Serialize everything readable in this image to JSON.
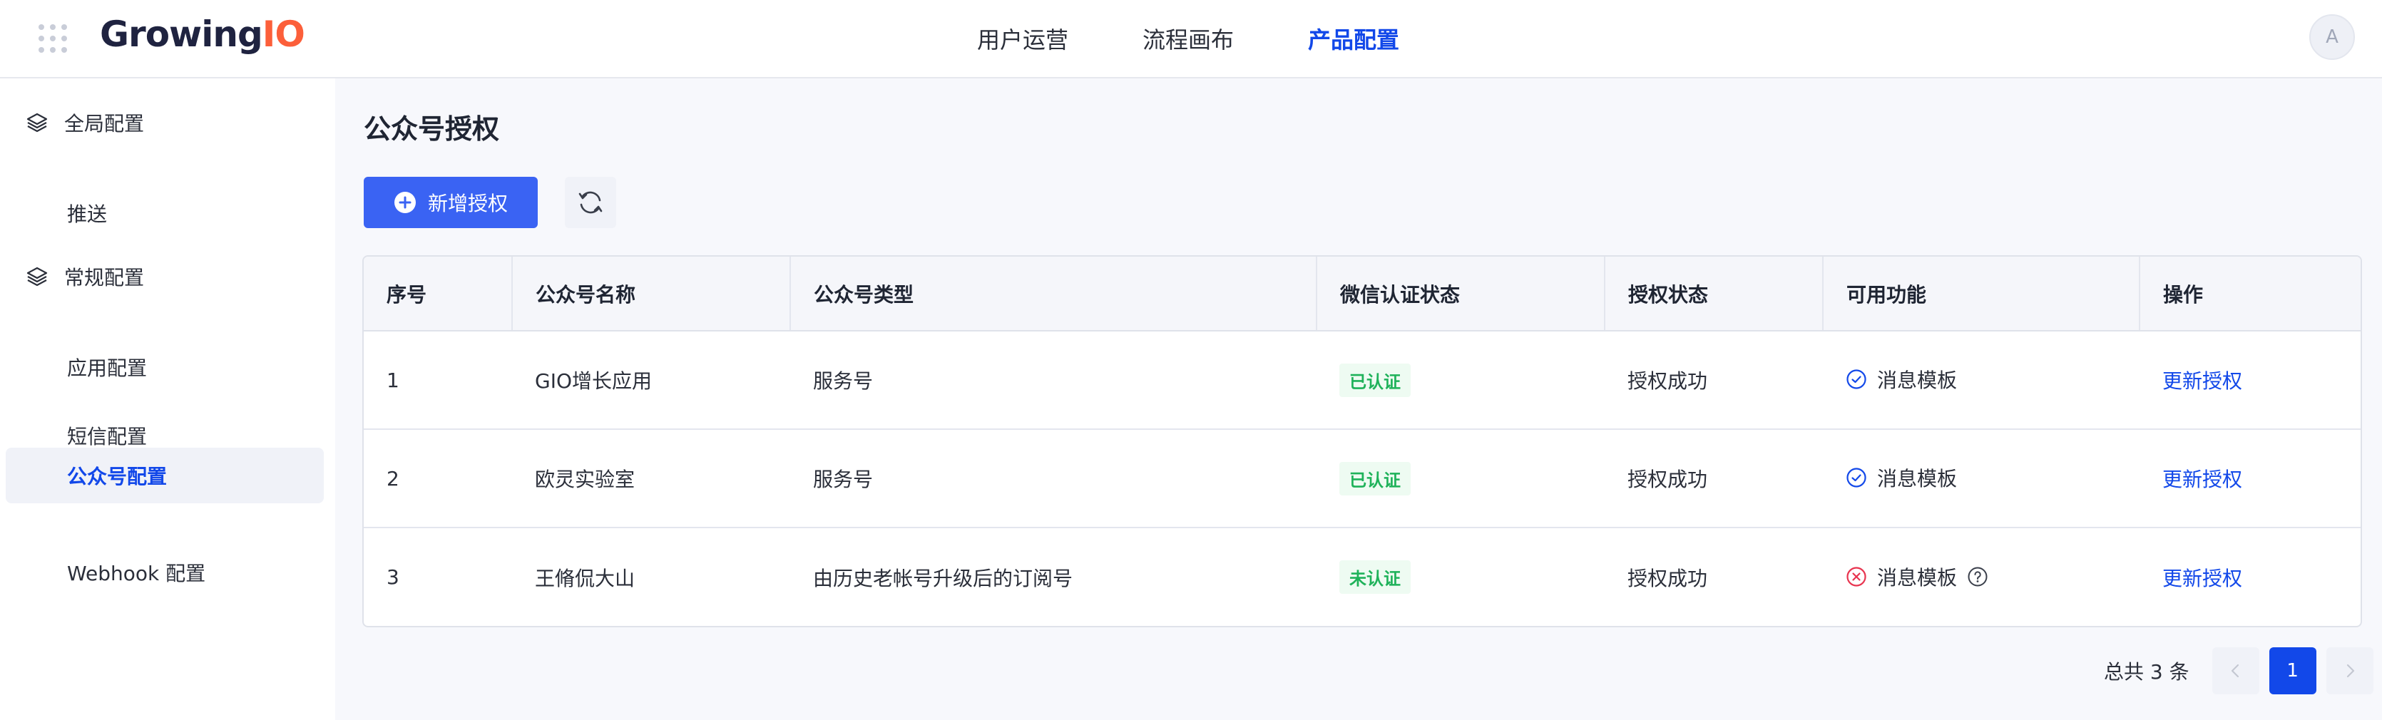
{
  "header": {
    "logo_text": "Growing",
    "logo_accent": "IO",
    "nav": [
      {
        "label": "用户运营"
      },
      {
        "label": "流程画布"
      },
      {
        "label": "产品配置"
      }
    ],
    "active_nav": "产品配置",
    "avatar_initial": "A"
  },
  "sidebar": {
    "groups": [
      {
        "label": "全局配置",
        "items": [
          {
            "label": "推送"
          }
        ]
      },
      {
        "label": "常规配置",
        "items": [
          {
            "label": "应用配置"
          },
          {
            "label": "短信配置"
          },
          {
            "label": "公众号配置"
          },
          {
            "label": "Webhook 配置"
          }
        ]
      }
    ],
    "active_item": "公众号配置"
  },
  "main": {
    "title": "公众号授权",
    "add_button_label": "新增授权",
    "table": {
      "columns": [
        "序号",
        "公众号名称",
        "公众号类型",
        "微信认证状态",
        "授权状态",
        "可用功能",
        "操作"
      ],
      "rows": [
        {
          "index": "1",
          "name": "GIO增长应用",
          "type": "服务号",
          "verify": "已认证",
          "auth": "授权成功",
          "feature": "消息模板",
          "feature_ok": true,
          "action": "更新授权"
        },
        {
          "index": "2",
          "name": "欧灵实验室",
          "type": "服务号",
          "verify": "已认证",
          "auth": "授权成功",
          "feature": "消息模板",
          "feature_ok": true,
          "action": "更新授权"
        },
        {
          "index": "3",
          "name": "王脩侃大山",
          "type": "由历史老帐号升级后的订阅号",
          "verify": "未认证",
          "auth": "授权成功",
          "feature": "消息模板",
          "feature_ok": false,
          "action": "更新授权"
        }
      ]
    },
    "pagination": {
      "total_text": "总共 3 条",
      "current_page": "1"
    }
  },
  "colors": {
    "brand": "#1248e9",
    "primary_button": "#3a63f3",
    "logo_accent": "#fc5f3a",
    "success_text": "#1fb25a",
    "error_icon": "#e8344f"
  }
}
